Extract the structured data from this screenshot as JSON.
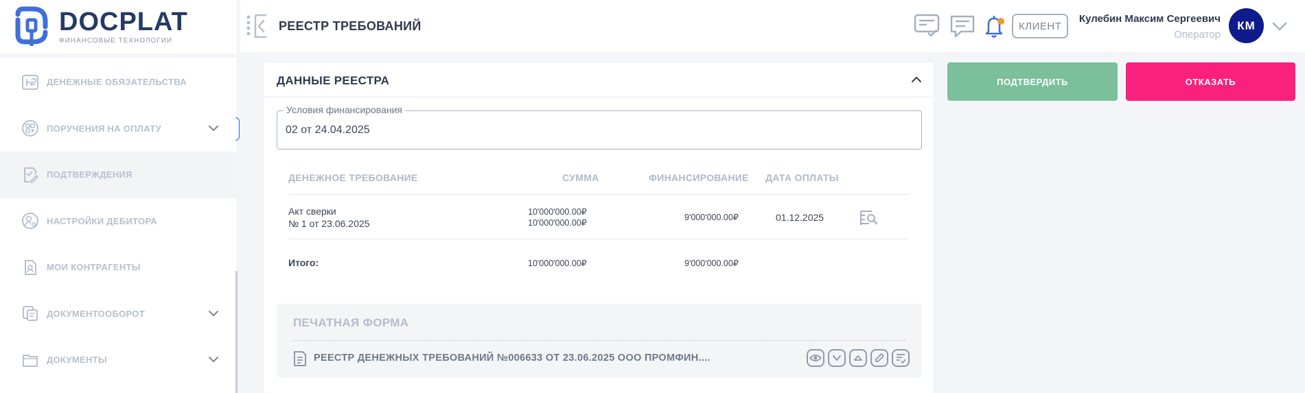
{
  "brand": {
    "name": "DOCPLAT",
    "tagline": "ФИНАНСОВЫЕ ТЕХНОЛОГИИ"
  },
  "sidebar": {
    "items": [
      {
        "label": "ДЕНЕЖНЫЕ ОБЯЗАТЕЛЬСТВА",
        "icon": "money-obligation-icon",
        "expandable": false
      },
      {
        "label": "ПОРУЧЕНИЯ НА ОПЛАТУ",
        "icon": "payment-order-icon",
        "expandable": true
      },
      {
        "label": "ПОДТВЕРЖДЕНИЯ",
        "icon": "confirmation-icon",
        "expandable": false,
        "active": true
      },
      {
        "label": "НАСТРОЙКИ ДЕБИТОРА",
        "icon": "debtor-settings-icon",
        "expandable": false
      },
      {
        "label": "МОИ КОНТРАГЕНТЫ",
        "icon": "counterparties-icon",
        "expandable": false
      },
      {
        "label": "ДОКУМЕНТООБОРОТ",
        "icon": "document-flow-icon",
        "expandable": true
      },
      {
        "label": "ДОКУМЕНТЫ",
        "icon": "documents-icon",
        "expandable": true
      }
    ]
  },
  "header": {
    "title": "РЕЕСТР ТРЕБОВАНИЙ",
    "role_badge": "КЛИЕНТ",
    "user": {
      "name": "Кулебин Максим Сергеевич",
      "role": "Оператор",
      "initials": "КМ"
    },
    "icons": [
      "tasks-icon",
      "messages-icon",
      "notifications-bell-icon"
    ],
    "notification_dot_color": "#f39a2b"
  },
  "registry": {
    "title": "ДАННЫЕ РЕЕСТРА",
    "financing_terms": {
      "label": "Условия финансирования",
      "value": "02 от 24.04.2025"
    },
    "columns": {
      "claim": "ДЕНЕЖНОЕ ТРЕБОВАНИЕ",
      "amount": "СУММА",
      "financing": "ФИНАНСИРОВАНИЕ",
      "pay_date": "ДАТА ОПЛАТЫ"
    },
    "rows": [
      {
        "claim_line1": "Акт сверки",
        "claim_line2": "№ 1 от 23.06.2025",
        "amount_line1": "10'000'000.00₽",
        "amount_line2": "10'000'000.00₽",
        "financing": "9'000'000.00₽",
        "pay_date": "01.12.2025"
      }
    ],
    "total": {
      "label": "Итого:",
      "amount": "10'000'000.00₽",
      "financing": "9'000'000.00₽"
    },
    "print_form": {
      "title": "ПЕЧАТНАЯ ФОРМА",
      "file": "РЕЕСТР ДЕНЕЖНЫХ ТРЕБОВАНИЙ №006633 ОТ 23.06.2025 ООО ПРОМФИН...."
    }
  },
  "actions": {
    "confirm": "ПОДТВЕРДИТЬ",
    "reject": "ОТКАЗАТЬ"
  },
  "colors": {
    "brand": "#253a66",
    "confirm": "#7bbf9b",
    "reject": "#fa207d",
    "avatar": "#0d1b8c"
  }
}
